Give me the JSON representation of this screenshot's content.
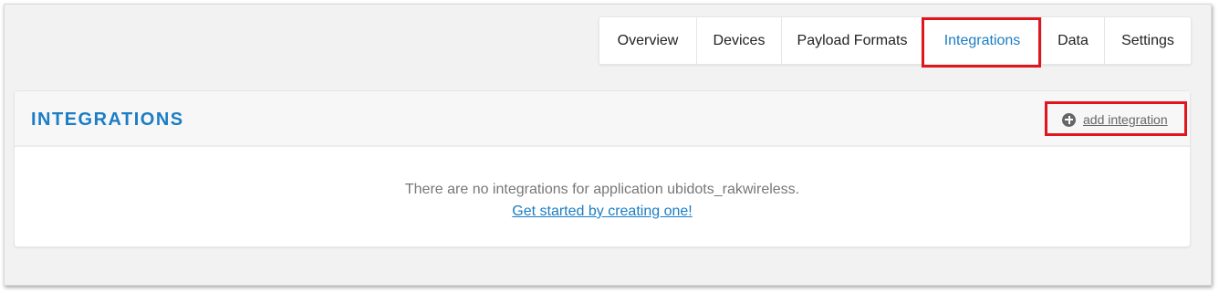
{
  "tabs": [
    {
      "label": "Overview",
      "active": false
    },
    {
      "label": "Devices",
      "active": false
    },
    {
      "label": "Payload Formats",
      "active": false
    },
    {
      "label": "Integrations",
      "active": true
    },
    {
      "label": "Data",
      "active": false
    },
    {
      "label": "Settings",
      "active": false
    }
  ],
  "integrations": {
    "title": "INTEGRATIONS",
    "add_label": "add integration",
    "empty_message": "There are no integrations for application ubidots_rakwireless.",
    "get_started_label": "Get started by creating one!"
  },
  "colors": {
    "accent": "#1b7dc4",
    "highlight": "#e0161c",
    "background": "#f2f2f2"
  },
  "icons": {
    "add": "plus-circle-icon"
  }
}
